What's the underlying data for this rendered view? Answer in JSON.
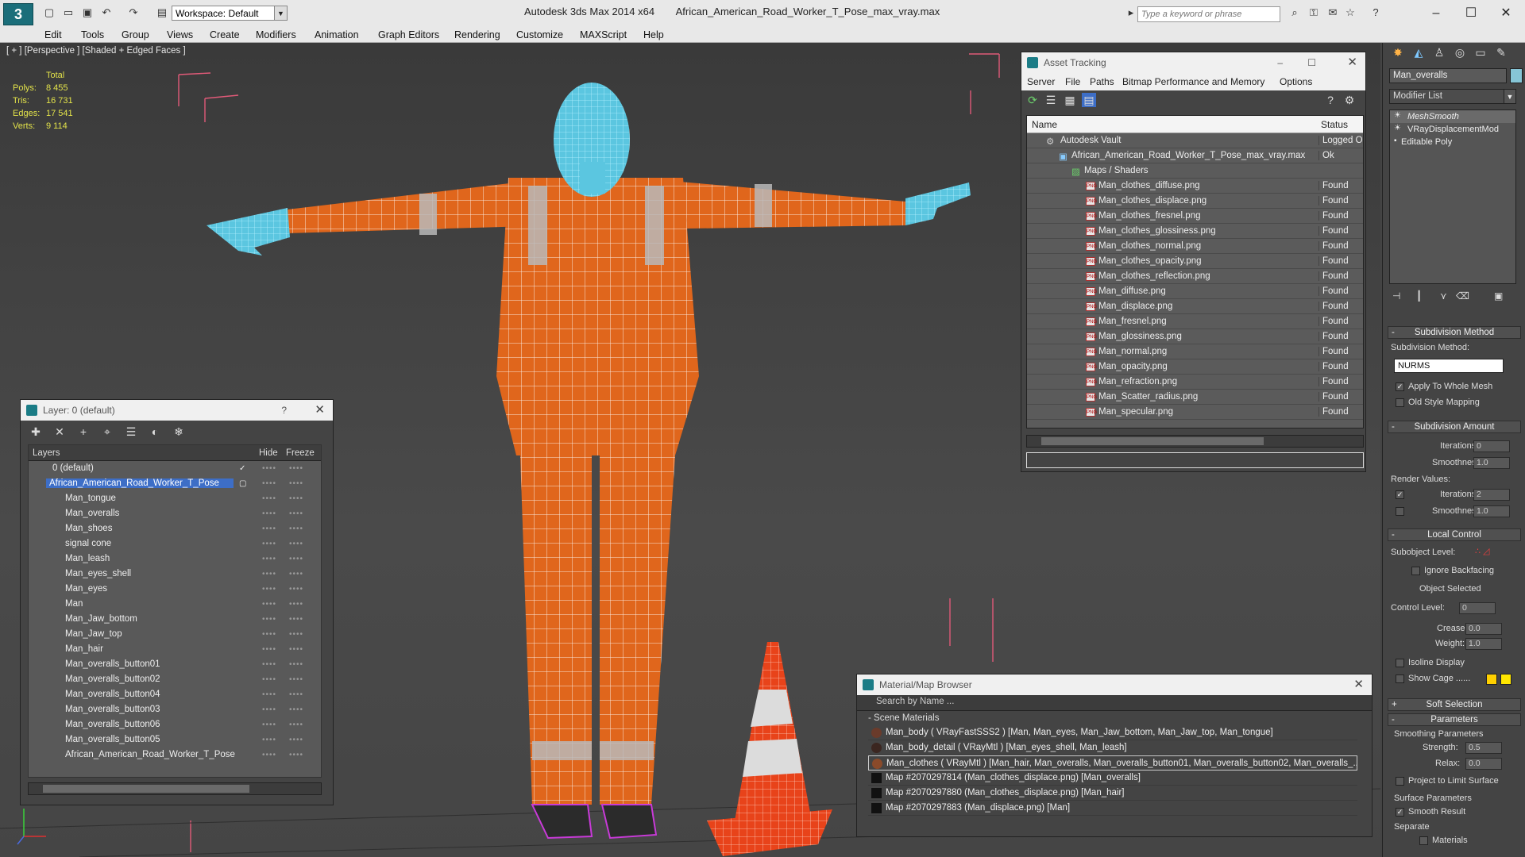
{
  "titlebar": {
    "workspace": "Workspace: Default",
    "app": "Autodesk 3ds Max  2014 x64",
    "file": "African_American_Road_Worker_T_Pose_max_vray.max",
    "search_placeholder": "Type a keyword or phrase"
  },
  "menu": [
    "Edit",
    "Tools",
    "Group",
    "Views",
    "Create",
    "Modifiers",
    "Animation",
    "Graph Editors",
    "Rendering",
    "Customize",
    "MAXScript",
    "Help"
  ],
  "viewport": {
    "label": "[ + ] [Perspective ] [Shaded + Edged Faces ]",
    "stats": {
      "header": "Total",
      "rows": [
        {
          "label": "Polys:",
          "value": "8 455"
        },
        {
          "label": "Tris:",
          "value": "16 731"
        },
        {
          "label": "Edges:",
          "value": "17 541"
        },
        {
          "label": "Verts:",
          "value": "9 114"
        }
      ]
    }
  },
  "layer_window": {
    "title": "Layer: 0 (default)",
    "help": "?",
    "cols": {
      "layers": "Layers",
      "hide": "Hide",
      "freeze": "Freeze"
    },
    "rows": [
      "0 (default)",
      "African_American_Road_Worker_T_Pose",
      "Man_tongue",
      "Man_overalls",
      "Man_shoes",
      "signal cone",
      "Man_leash",
      "Man_eyes_shell",
      "Man_eyes",
      "Man",
      "Man_Jaw_bottom",
      "Man_Jaw_top",
      "Man_hair",
      "Man_overalls_button01",
      "Man_overalls_button02",
      "Man_overalls_button04",
      "Man_overalls_button03",
      "Man_overalls_button06",
      "Man_overalls_button05",
      "African_American_Road_Worker_T_Pose"
    ],
    "check": "✓"
  },
  "asset_window": {
    "title": "Asset Tracking",
    "menu": [
      "Server",
      "File",
      "Paths",
      "Bitmap Performance and Memory",
      "Options"
    ],
    "cols": {
      "name": "Name",
      "status": "Status"
    },
    "root": {
      "name": "Autodesk Vault",
      "status": "Logged Ou"
    },
    "file": {
      "name": "African_American_Road_Worker_T_Pose_max_vray.max",
      "status": "Ok"
    },
    "group": "Maps / Shaders",
    "maps": [
      "Man_clothes_diffuse.png",
      "Man_clothes_displace.png",
      "Man_clothes_fresnel.png",
      "Man_clothes_glossiness.png",
      "Man_clothes_normal.png",
      "Man_clothes_opacity.png",
      "Man_clothes_reflection.png",
      "Man_diffuse.png",
      "Man_displace.png",
      "Man_fresnel.png",
      "Man_glossiness.png",
      "Man_normal.png",
      "Man_opacity.png",
      "Man_refraction.png",
      "Man_Scatter_radius.png",
      "Man_specular.png"
    ],
    "found": "Found"
  },
  "material_browser": {
    "title": "Material/Map Browser",
    "search": "Search by Name ...",
    "section": "- Scene Materials",
    "rows": [
      {
        "text": "Man_body  ( VRayFastSSS2 ) [Man, Man_eyes, Man_Jaw_bottom, Man_Jaw_top, Man_tongue]",
        "map": false
      },
      {
        "text": "Man_body_detail  ( VRayMtl ) [Man_eyes_shell, Man_leash]",
        "map": false
      },
      {
        "text": "Man_clothes  ( VRayMtl ) [Man_hair, Man_overalls, Man_overalls_button01, Man_overalls_button02, Man_overalls_...",
        "map": false
      },
      {
        "text": "Map #2070297814 (Man_clothes_displace.png) [Man_overalls]",
        "map": true
      },
      {
        "text": "Map #2070297880 (Man_clothes_displace.png) [Man_hair]",
        "map": true
      },
      {
        "text": "Map #2070297883 (Man_displace.png) [Man]",
        "map": true
      }
    ]
  },
  "command_panel": {
    "object_name": "Man_overalls",
    "modifier_list": "Modifier List",
    "stack": [
      "MeshSmooth",
      "VRayDisplacementMod",
      "Editable Poly"
    ],
    "sub_method": {
      "header": "Subdivision Method",
      "label": "Subdivision Method:",
      "value": "NURMS",
      "apply": "Apply To Whole Mesh",
      "old": "Old Style Mapping"
    },
    "sub_amount": {
      "header": "Subdivision Amount",
      "iterations": "Iterations:",
      "iter_val": "0",
      "smoothness": "Smoothness:",
      "smooth_val": "1.0",
      "render": "Render Values:",
      "r_iter_val": "2",
      "r_smooth_val": "1.0"
    },
    "local": {
      "header": "Local Control",
      "sublevel": "Subobject Level:",
      "ignore": "Ignore Backfacing",
      "selected": "Object Selected",
      "control": "Control Level:",
      "control_val": "0",
      "crease": "Crease:",
      "crease_val": "0.0",
      "weight": "Weight:",
      "weight_val": "1.0",
      "isoline": "Isoline Display",
      "cage": "Show Cage ......"
    },
    "soft": "Soft Selection",
    "params": {
      "header": "Parameters",
      "smooth": "Smoothing Parameters",
      "strength": "Strength:",
      "strength_val": "0.5",
      "relax": "Relax:",
      "relax_val": "0.0",
      "project": "Project to Limit Surface",
      "surface": "Surface Parameters",
      "smooth_result": "Smooth Result",
      "separate": "Separate",
      "materials": "Materials"
    }
  },
  "colors": {
    "overalls": "#e0661c",
    "stripe": "#b9b9b9",
    "wire": "#ffffff",
    "head": "#5bc6e0",
    "cone": "#e8431a",
    "shoes": "#c83ad8",
    "cage1": "#ffd000",
    "cage2": "#ffe600"
  }
}
